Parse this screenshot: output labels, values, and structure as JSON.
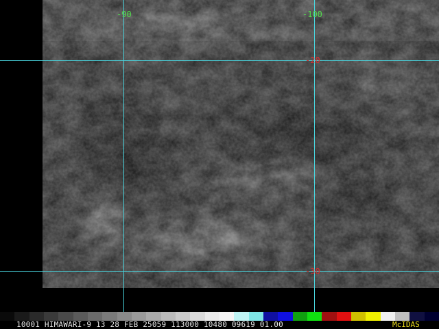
{
  "grid": {
    "line_color": "#49d4dd",
    "longitude_labels": [
      "-90",
      "-100"
    ],
    "latitude_labels": [
      "-20",
      "-30"
    ],
    "longitude_label_color": "#52e04c",
    "latitude_label_color": "#e03030"
  },
  "status": {
    "text": "10001 HIMAWARI-9 13 28 FEB 25059 113000 10480 09619 01.00",
    "brand": "McIDAS",
    "brand_color": "#f0e020"
  },
  "colorbar": {
    "colors": [
      "#0a0a0a",
      "#1a1a1a",
      "#2a2a2a",
      "#3a3a3a",
      "#4a4a4a",
      "#5a5a5a",
      "#6a6a6a",
      "#7a7a7a",
      "#8a8a8a",
      "#9a9a9a",
      "#aaaaaa",
      "#bababa",
      "#cacaca",
      "#dadada",
      "#eaeaea",
      "#f6f6f6",
      "#bff4f4",
      "#7fe6e6",
      "#1010a0",
      "#1010e0",
      "#10a010",
      "#10e010",
      "#a01010",
      "#e01010",
      "#d0c000",
      "#f0f000",
      "#f0f0f0",
      "#c0c0c0",
      "#101040",
      "#000030"
    ]
  }
}
